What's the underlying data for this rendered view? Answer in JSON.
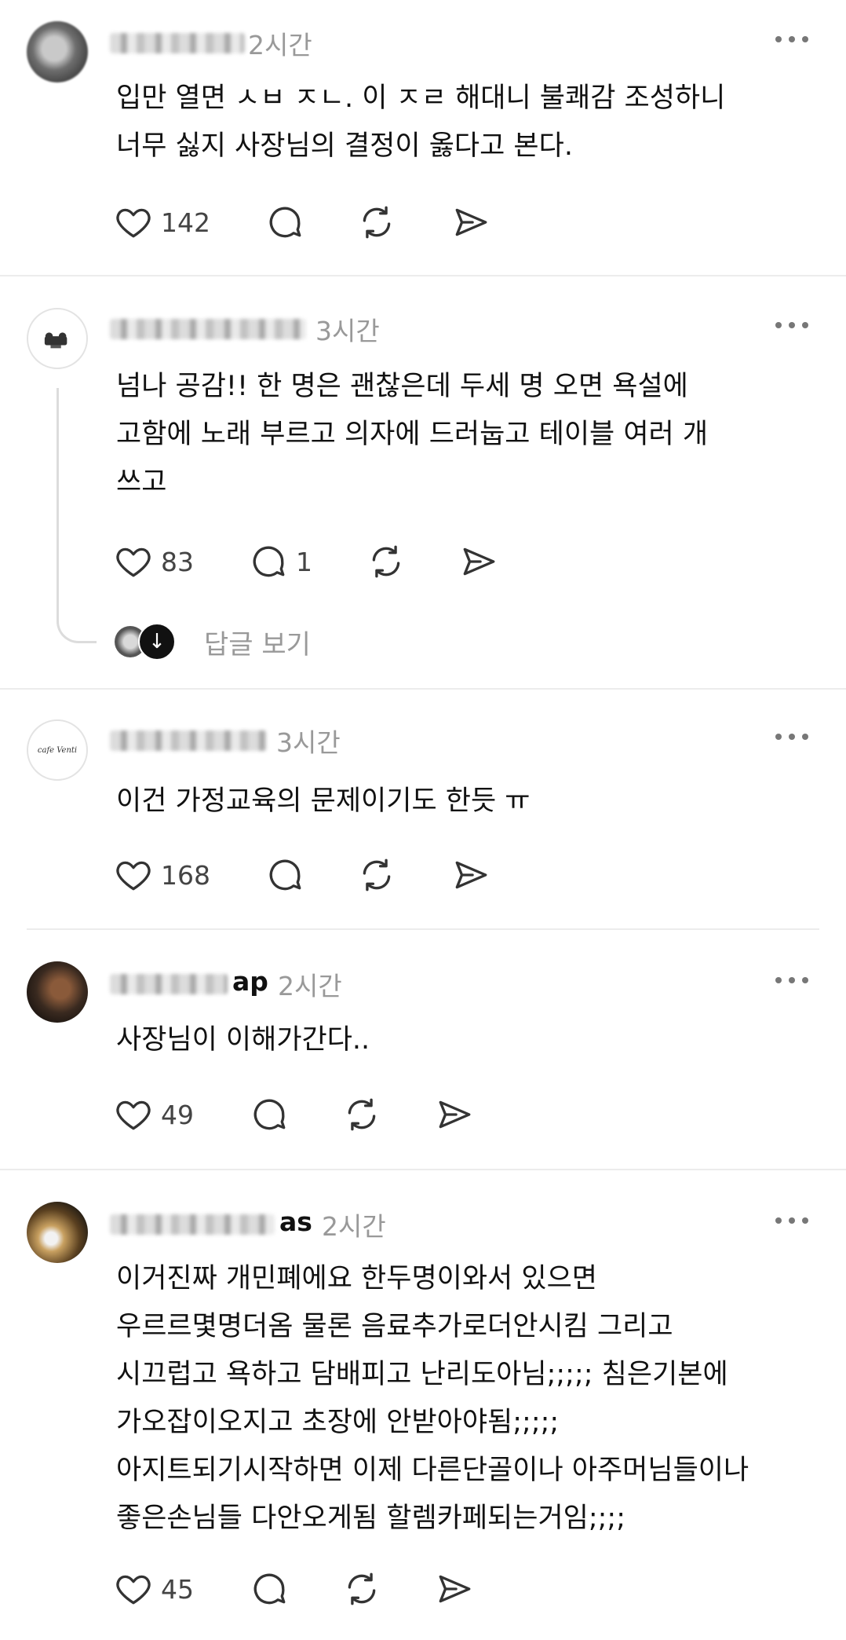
{
  "posts": [
    {
      "name_suffix": "",
      "time": "2시간",
      "text": "입만 열면 ㅅㅂ ㅈㄴ. 이 ㅈㄹ 해대니 불쾌감 조성하니\n너무 싫지 사장님의 결정이 옳다고 본다.",
      "likes": "142",
      "replies": ""
    },
    {
      "name_suffix": "",
      "time": "3시간",
      "text": "넘나 공감!! 한 명은 괜찮은데 두세 명 오면 욕설에\n고함에 노래 부르고 의자에 드러눕고 테이블 여러 개\n쓰고",
      "likes": "83",
      "replies": "1",
      "view_replies_label": "답글 보기"
    },
    {
      "name_suffix": "",
      "time": "3시간",
      "avatar_text": "cafe Venti",
      "text": "이건 가정교육의 문제이기도 한듯 ㅠ",
      "likes": "168",
      "replies": ""
    },
    {
      "name_suffix": "ap",
      "time": "2시간",
      "text": "사장님이 이해가간다..",
      "likes": "49",
      "replies": ""
    },
    {
      "name_suffix": "as",
      "time": "2시간",
      "text": "이거진짜 개민폐에요 한두명이와서 있으면\n우르르몇명더옴 물론 음료추가로더안시킴 그리고\n시끄럽고 욕하고 담배피고 난리도아님;;;;; 침은기본에\n가오잡이오지고 초장에 안받아야됨;;;;;\n아지트되기시작하면 이제 다른단골이나 아주머님들이나\n좋은손님들 다안오게됨 할렘카페되는거임;;;;",
      "likes": "45",
      "replies": ""
    }
  ],
  "colors": {
    "text": "#111111",
    "meta": "#999999",
    "icon": "#333333",
    "divider": "#ececec"
  }
}
